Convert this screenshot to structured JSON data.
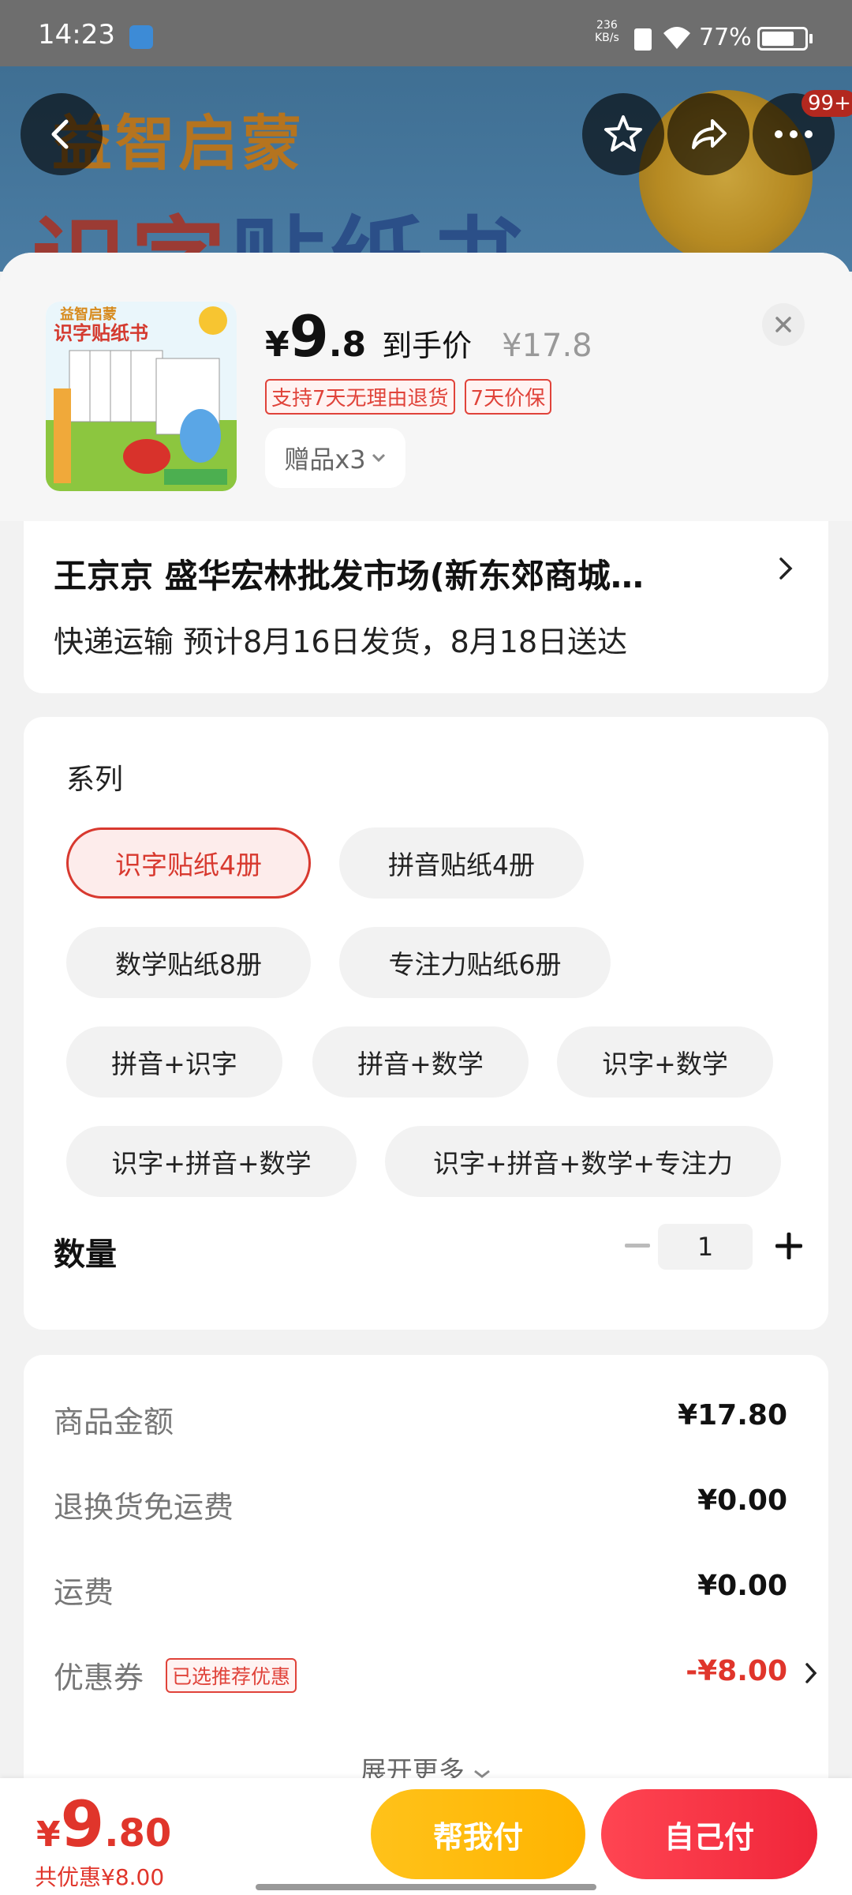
{
  "status_bar": {
    "time": "14:23",
    "net_speed_value": "236",
    "net_speed_unit": "KB/s",
    "battery_percent": "77%"
  },
  "banner": {
    "title_line1": "益智启蒙",
    "title_line2_a": "识字",
    "title_line2_b": "贴纸书",
    "more_badge": "99+"
  },
  "product": {
    "price_yen": "¥",
    "price_int": "9",
    "price_dec": ".8",
    "price_label": "到手价",
    "original_price": "¥17.8",
    "tags": [
      "支持7天无理由退货",
      "7天价保"
    ],
    "gift_label": "赠品x3",
    "thumbnail": {
      "top_text": "益智启蒙",
      "title": "识字贴纸书"
    }
  },
  "address": {
    "line": "王京京  盛华宏林批发市场(新东郊商城…",
    "shipping": "快递运输 预计8月16日发货，8月18日送达"
  },
  "spec": {
    "title": "系列",
    "options": [
      "识字贴纸4册",
      "拼音贴纸4册",
      "数学贴纸8册",
      "专注力贴纸6册",
      "拼音+识字",
      "拼音+数学",
      "识字+数学",
      "识字+拼音+数学",
      "识字+拼音+数学+专注力"
    ],
    "selected": "识字贴纸4册"
  },
  "quantity": {
    "label": "数量",
    "value": "1"
  },
  "costs": {
    "goods_label": "商品金额",
    "goods_value": "¥17.80",
    "return_label": "退换货免运费",
    "return_value": "¥0.00",
    "shipping_label": "运费",
    "shipping_value": "¥0.00",
    "coupon_label": "优惠券",
    "coupon_tag": "已选推荐优惠",
    "coupon_value": "-¥8.00",
    "expand_label": "展开更多"
  },
  "bottom": {
    "total_yen": "¥",
    "total_int": "9",
    "total_dec": ".80",
    "saved": "共优惠¥8.00",
    "help_pay": "帮我付",
    "self_pay": "自己付"
  },
  "colors": {
    "accent_red": "#e0352b",
    "help_yellow": "#ffb400",
    "pay_red": "#f0263a"
  }
}
